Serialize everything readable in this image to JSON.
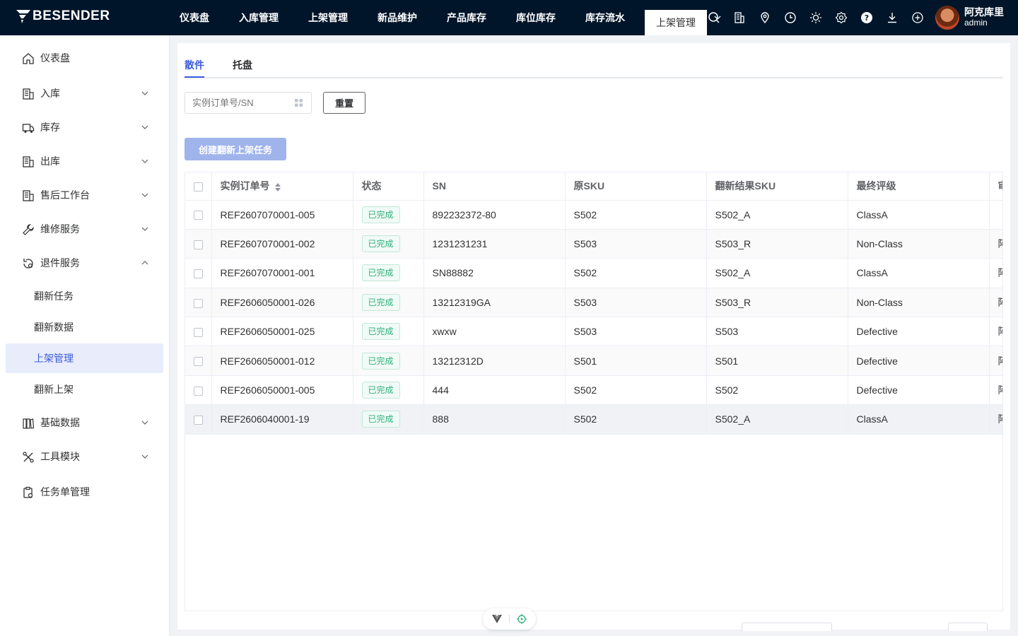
{
  "brand": "BESENDER",
  "topnav": {
    "items": [
      "仪表盘",
      "入库管理",
      "上架管理",
      "新品维护",
      "产品库存",
      "库位库存",
      "库存流水"
    ],
    "active": "上架管理"
  },
  "toolbar_icons": [
    "search-icon",
    "building-icon",
    "location-icon",
    "clock-icon",
    "sun-icon",
    "settings-icon",
    "help-icon",
    "download-icon",
    "plus-circle-icon"
  ],
  "user": {
    "name": "阿克库里",
    "role": "admin"
  },
  "sidebar": {
    "items": [
      {
        "label": "仪表盘",
        "icon": "home-icon"
      },
      {
        "label": "入库",
        "icon": "inbound-icon"
      },
      {
        "label": "库存",
        "icon": "truck-icon"
      },
      {
        "label": "出库",
        "icon": "outbound-icon"
      },
      {
        "label": "售后工作台",
        "icon": "aftersale-icon"
      },
      {
        "label": "维修服务",
        "icon": "wrench-icon"
      },
      {
        "label": "退件服务",
        "icon": "return-icon"
      },
      {
        "label": "基础数据",
        "icon": "data-icon"
      },
      {
        "label": "工具模块",
        "icon": "tools-icon"
      },
      {
        "label": "任务单管理",
        "icon": "tasklist-icon"
      }
    ],
    "sub_items": [
      "翻新任务",
      "翻新数据",
      "上架管理",
      "翻新上架"
    ],
    "active_sub": "上架管理"
  },
  "tabs": [
    "散件",
    "托盘"
  ],
  "filters": {
    "search_placeholder": "实例订单号/SN",
    "reset_label": "重置"
  },
  "create_button": "创建翻新上架任务",
  "table": {
    "columns": [
      "实例订单号",
      "状态",
      "SN",
      "原SKU",
      "翻新结果SKU",
      "最终评级",
      "审"
    ],
    "rows": [
      [
        "REF2607070001-005",
        "已完成",
        "892232372-80",
        "S502",
        "S502_A",
        "ClassA",
        ""
      ],
      [
        "REF2607070001-002",
        "已完成",
        "1231231231",
        "S503",
        "S503_R",
        "Non-Class",
        "阿"
      ],
      [
        "REF2607070001-001",
        "已完成",
        "SN88882",
        "S502",
        "S502_A",
        "ClassA",
        "阿"
      ],
      [
        "REF2606050001-026",
        "已完成",
        "13212319GA",
        "S503",
        "S503_R",
        "Non-Class",
        "阿"
      ],
      [
        "REF2606050001-025",
        "已完成",
        "xwxw",
        "S503",
        "S503",
        "Defective",
        "阿"
      ],
      [
        "REF2606050001-012",
        "已完成",
        "13212312D",
        "S501",
        "S501",
        "Defective",
        "阿"
      ],
      [
        "REF2606050001-005",
        "已完成",
        "444",
        "S502",
        "S502",
        "Defective",
        "阿"
      ],
      [
        "REF2606040001-19",
        "已完成",
        "888",
        "S502",
        "S502_A",
        "ClassA",
        "阿"
      ]
    ]
  },
  "colors": {
    "topbar": "#001529",
    "accent": "#3b5bdb",
    "status_done": "#2fb07c"
  }
}
